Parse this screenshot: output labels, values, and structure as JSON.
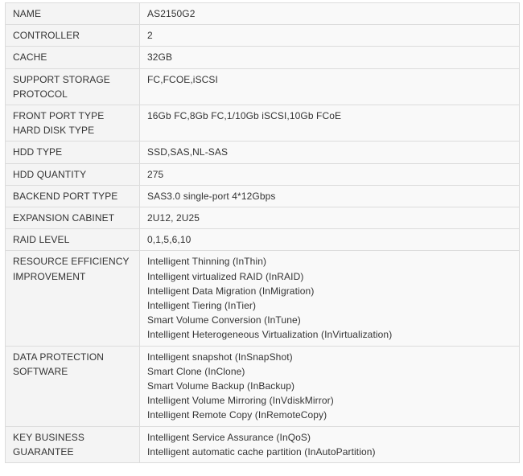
{
  "spec_rows": [
    {
      "key": "NAME",
      "value": [
        "AS2150G2"
      ]
    },
    {
      "key": "CONTROLLER",
      "value": [
        "2"
      ]
    },
    {
      "key": "CACHE",
      "value": [
        "32GB"
      ]
    },
    {
      "key": "SUPPORT STORAGE PROTOCOL",
      "value": [
        "FC,FCOE,iSCSI"
      ]
    },
    {
      "key": "FRONT PORT TYPE HARD DISK TYPE",
      "value": [
        "16Gb FC,8Gb FC,1/10Gb iSCSI,10Gb FCoE"
      ]
    },
    {
      "key": "HDD TYPE",
      "value": [
        "SSD,SAS,NL-SAS"
      ]
    },
    {
      "key": "HDD QUANTITY",
      "value": [
        "275"
      ]
    },
    {
      "key": "BACKEND PORT TYPE",
      "value": [
        "SAS3.0 single-port 4*12Gbps"
      ]
    },
    {
      "key": "EXPANSION CABINET",
      "value": [
        "2U12, 2U25"
      ]
    },
    {
      "key": "RAID LEVEL",
      "value": [
        "0,1,5,6,10"
      ]
    },
    {
      "key": "RESOURCE EFFICIENCY IMPROVEMENT",
      "value": [
        "Intelligent Thinning (InThin)",
        "Intelligent virtualized RAID (InRAID)",
        "Intelligent Data Migration (InMigration)",
        "Intelligent Tiering (InTier)",
        "Smart Volume Conversion (InTune)",
        "Intelligent Heterogeneous Virtualization (InVirtualization)"
      ]
    },
    {
      "key": "DATA PROTECTION SOFTWARE",
      "value": [
        "Intelligent snapshot (InSnapShot)",
        "Smart Clone (InClone)",
        "Smart Volume Backup (InBackup)",
        "Intelligent Volume Mirroring (InVdiskMirror)",
        "Intelligent Remote Copy (InRemoteCopy)"
      ]
    },
    {
      "key": "KEY BUSINESS GUARANTEE",
      "value": [
        "Intelligent Service Assurance (InQoS)",
        "Intelligent automatic cache partition (InAutoPartition)"
      ]
    }
  ]
}
